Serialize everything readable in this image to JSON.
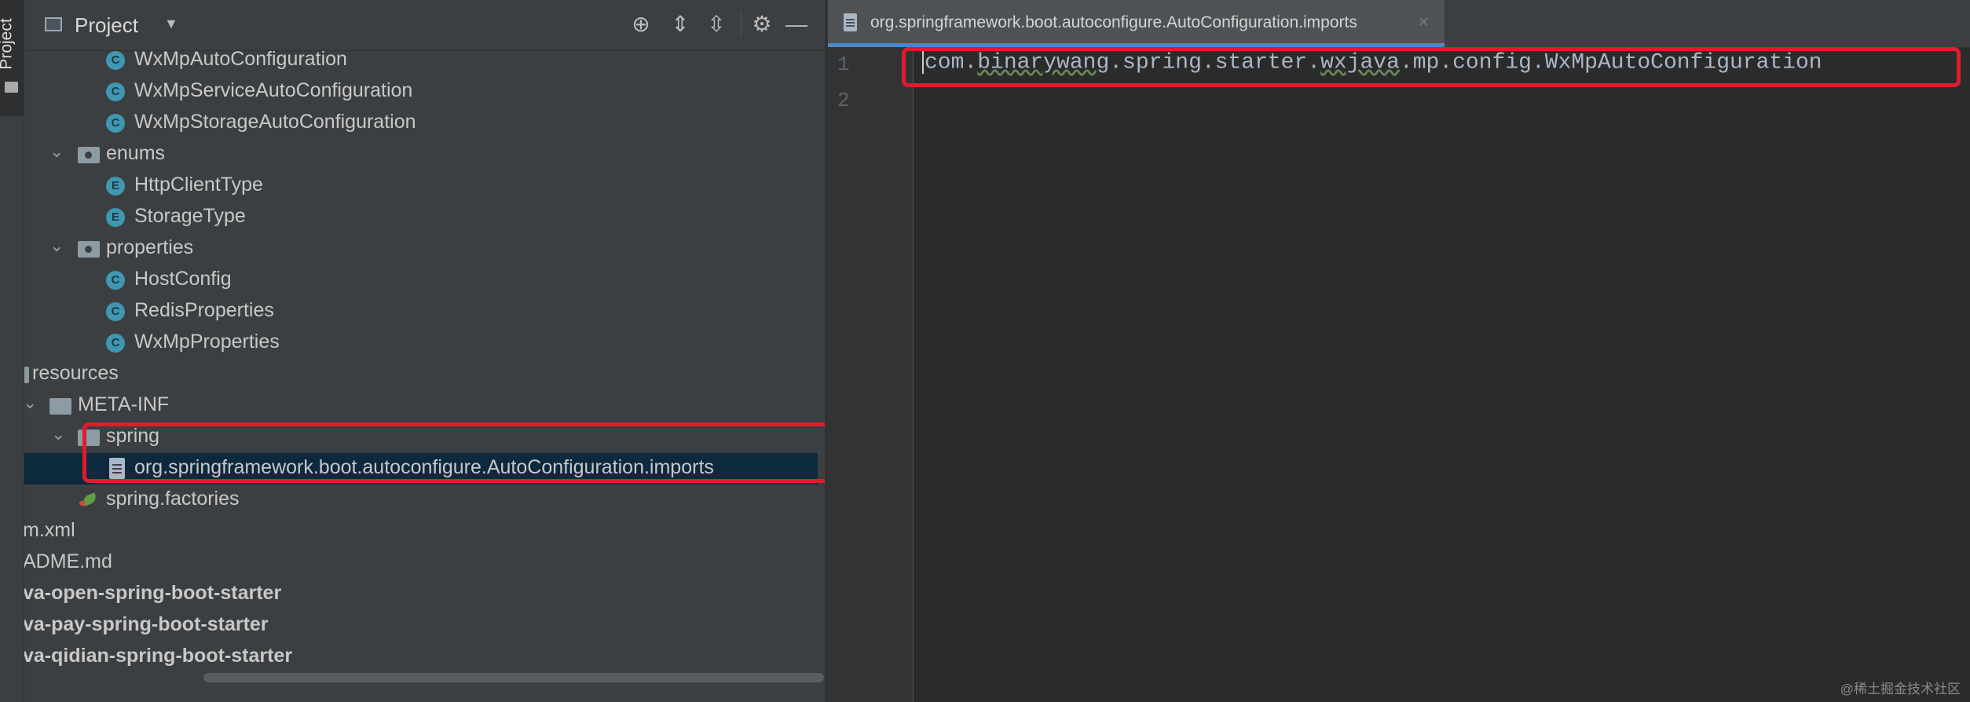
{
  "tool_strip": {
    "tab_label": "Project"
  },
  "project_panel": {
    "title": "Project",
    "tree": [
      {
        "label": "WxMpAutoConfiguration",
        "kind": "class",
        "icon_letter": "C",
        "bold": false
      },
      {
        "label": "WxMpServiceAutoConfiguration",
        "kind": "class",
        "icon_letter": "C",
        "bold": false
      },
      {
        "label": "WxMpStorageAutoConfiguration",
        "kind": "class",
        "icon_letter": "C",
        "bold": false
      },
      {
        "label": "enums",
        "kind": "package",
        "bold": false
      },
      {
        "label": "HttpClientType",
        "kind": "enum",
        "icon_letter": "E",
        "bold": false
      },
      {
        "label": "StorageType",
        "kind": "enum",
        "icon_letter": "E",
        "bold": false
      },
      {
        "label": "properties",
        "kind": "package",
        "bold": false
      },
      {
        "label": "HostConfig",
        "kind": "class",
        "icon_letter": "C",
        "bold": false
      },
      {
        "label": "RedisProperties",
        "kind": "class",
        "icon_letter": "C",
        "bold": false
      },
      {
        "label": "WxMpProperties",
        "kind": "class",
        "icon_letter": "C",
        "bold": false
      },
      {
        "label": "resources",
        "kind": "folder",
        "bold": false
      },
      {
        "label": "META-INF",
        "kind": "folder",
        "bold": false
      },
      {
        "label": "spring",
        "kind": "folder",
        "bold": false
      },
      {
        "label": "org.springframework.boot.autoconfigure.AutoConfiguration.imports",
        "kind": "file",
        "bold": false,
        "selected": true
      },
      {
        "label": "spring.factories",
        "kind": "spring-config",
        "bold": false
      },
      {
        "label": "m.xml",
        "kind": "plain",
        "bold": false
      },
      {
        "label": "ADME.md",
        "kind": "plain",
        "bold": false
      },
      {
        "label": "va-open-spring-boot-starter",
        "kind": "module",
        "bold": true
      },
      {
        "label": "va-pay-spring-boot-starter",
        "kind": "module",
        "bold": true
      },
      {
        "label": "va-qidian-spring-boot-starter",
        "kind": "module",
        "bold": true
      }
    ]
  },
  "editor": {
    "tab_label": "org.springframework.boot.autoconfigure.AutoConfiguration.imports",
    "tab_close": "×",
    "line_numbers": [
      "1",
      "2"
    ],
    "code": {
      "part1": "com.",
      "part2": "binarywang",
      "part3": ".spring.starter.",
      "part4": "wxjava",
      "part5": ".mp.config.WxMpAutoConfiguration"
    }
  },
  "watermark": "@稀土掘金技术社区",
  "colors": {
    "highlight_box": "#e01c2c",
    "selection": "#0d293e",
    "active_tab_underline": "#4a88c7",
    "class_icon": "#3f97b0"
  }
}
